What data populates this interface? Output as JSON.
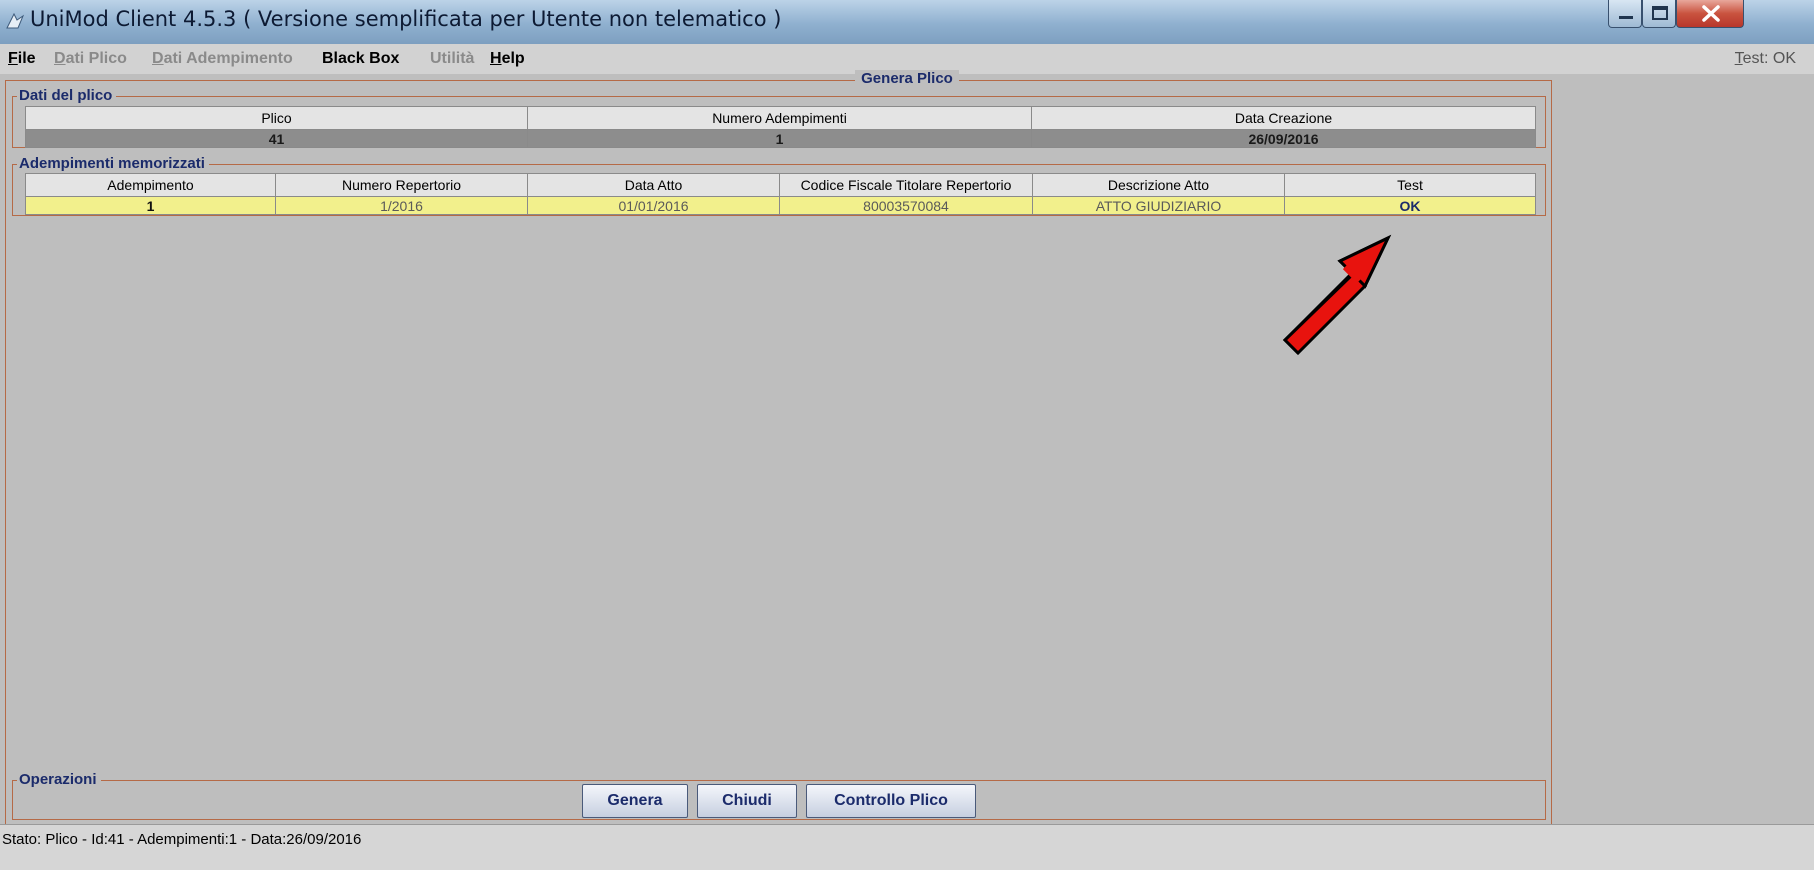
{
  "window": {
    "title": "UniMod Client  4.5.3  ( Versione semplificata per Utente non telematico )"
  },
  "menubar": {
    "items": [
      {
        "label_first": "F",
        "label_rest": "ile",
        "enabled": true
      },
      {
        "label_first": "D",
        "label_rest": "ati Plico",
        "enabled": false
      },
      {
        "label_first": "D",
        "label_rest": "ati Adempimento",
        "enabled": false
      },
      {
        "label": "Black Box",
        "enabled": true
      },
      {
        "label": "Utilità",
        "enabled": false
      },
      {
        "label_first": "H",
        "label_rest": "elp",
        "enabled": true
      }
    ],
    "test_status_first": "T",
    "test_status_rest": "est: OK"
  },
  "main": {
    "title": "Genera Plico"
  },
  "plico_section": {
    "title": "Dati del plico",
    "columns": [
      "Plico",
      "Numero Adempimenti",
      "Data Creazione"
    ],
    "row": [
      "41",
      "1",
      "26/09/2016"
    ]
  },
  "adempimenti_section": {
    "title": "Adempimenti memorizzati",
    "columns": [
      "Adempimento",
      "Numero Repertorio",
      "Data Atto",
      "Codice Fiscale Titolare Repertorio",
      "Descrizione Atto",
      "Test"
    ],
    "rows": [
      [
        "1",
        "1/2016",
        "01/01/2016",
        "80003570084",
        "ATTO GIUDIZIARIO",
        "OK"
      ]
    ]
  },
  "operations": {
    "title": "Operazioni",
    "genera_label": "Genera",
    "chiudi_label": "Chiudi",
    "controllo_label": "Controllo Plico"
  },
  "statusbar": {
    "text": "Stato: Plico - Id:41 - Adempimenti:1 - Data:26/09/2016"
  },
  "colors": {
    "accent_title": "#1b2b6b",
    "row_highlight": "#f2f08c",
    "annotation_arrow": "#e8130e"
  }
}
